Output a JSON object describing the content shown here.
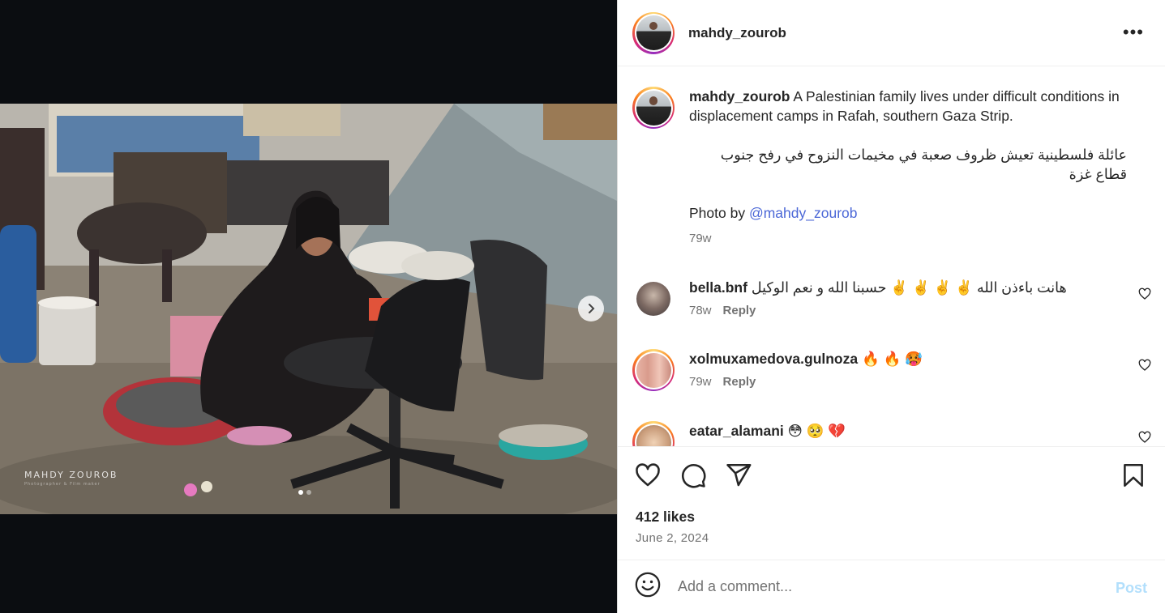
{
  "author": {
    "username": "mahdy_zourob"
  },
  "caption": {
    "username": "mahdy_zourob",
    "text_en": "A Palestinian family lives under difficult conditions in displacement camps in Rafah, southern Gaza Strip.",
    "text_ar": "عائلة فلسطينية تعيش ظروف صعبة في مخيمات النزوح في رفح جنوب قطاع غزة",
    "photo_by_prefix": "Photo by ",
    "photo_by_mention": "@mahdy_zourob",
    "time": "79w"
  },
  "comments": [
    {
      "username": "bella.bnf",
      "text": "هانت باءذن الله ✌️ ✌️ ✌️ ✌️ حسبنا الله و نعم الوكيل",
      "time": "78w",
      "reply_label": "Reply"
    },
    {
      "username": "xolmuxamedova.gulnoza",
      "text": "🔥 🔥 🥵",
      "time": "79w",
      "reply_label": "Reply"
    },
    {
      "username": "eatar_alamani",
      "text": "😳 🥺 💔",
      "time": "",
      "reply_label": ""
    }
  ],
  "media": {
    "watermark": "MAHDY ZOUROB",
    "watermark_sub": "Photographer & Film maker",
    "slide_index": 1,
    "slide_count": 2
  },
  "stats": {
    "likes": "412 likes",
    "date": "June 2, 2024"
  },
  "comment_input": {
    "placeholder": "Add a comment...",
    "post_label": "Post"
  },
  "icons": {
    "more": "more-options-icon",
    "like": "heart-icon",
    "comment": "comment-icon",
    "share": "share-icon",
    "save": "bookmark-icon",
    "emoji": "emoji-icon",
    "next": "chevron-right-icon"
  },
  "colors": {
    "link": "#4c68d7",
    "post_button": "#b2dffc",
    "muted": "#737373",
    "text": "#262626"
  }
}
